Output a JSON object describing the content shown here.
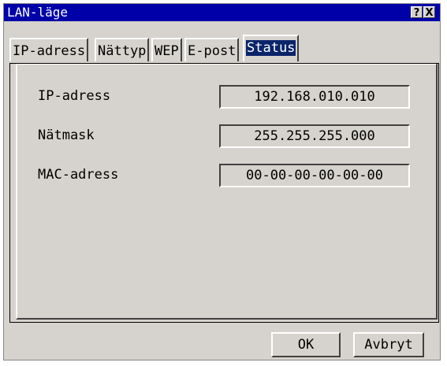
{
  "window": {
    "title": "LAN-läge",
    "help_glyph": "?",
    "close_glyph": "X"
  },
  "tabs": [
    {
      "label": "IP-adress",
      "active": false
    },
    {
      "label": "Nättyp",
      "active": false
    },
    {
      "label": "WEP",
      "active": false
    },
    {
      "label": "E-post",
      "active": false
    },
    {
      "label": "Status",
      "active": true
    }
  ],
  "status": {
    "ip_label": "IP-adress",
    "ip_value": "192.168.010.010",
    "mask_label": "Nätmask",
    "mask_value": "255.255.255.000",
    "mac_label": "MAC-adress",
    "mac_value": "00-00-00-00-00-00"
  },
  "buttons": {
    "ok": "OK",
    "cancel": "Avbryt"
  },
  "colors": {
    "titlebar": "#0000a8",
    "face": "#d6d3ce",
    "active_tab_highlight": "#0a246a"
  }
}
